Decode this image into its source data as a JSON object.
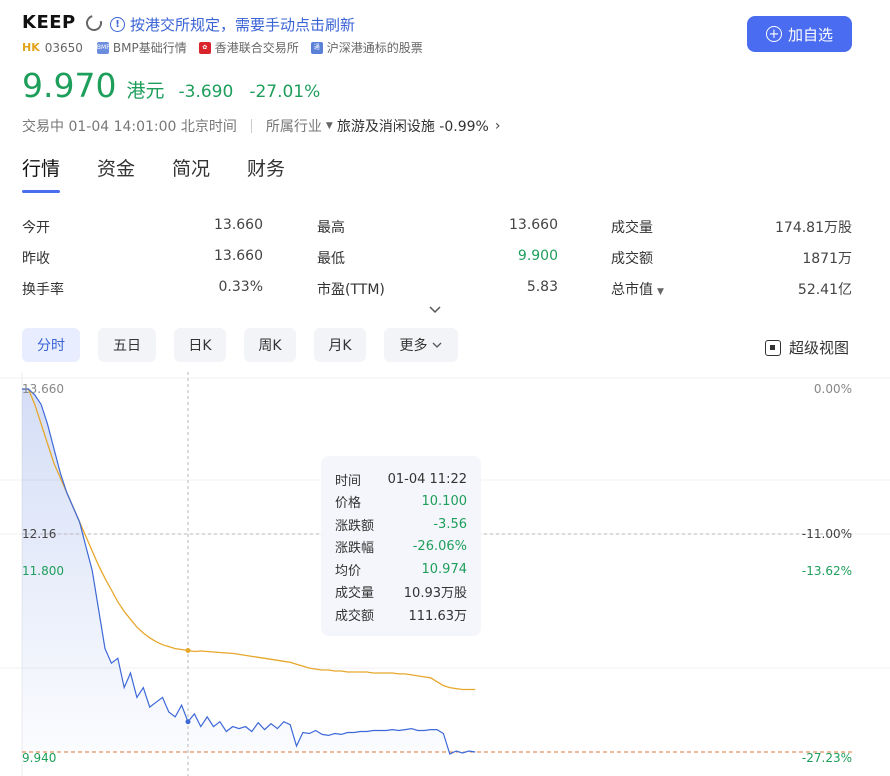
{
  "header": {
    "ticker": "KEEP",
    "notice": "按港交所规定，需要手动点击刷新",
    "market": "HK",
    "code": "03650",
    "badges": [
      "BMP基础行情",
      "香港联合交易所",
      "沪深港通标的股票"
    ],
    "add_button": "加自选"
  },
  "quote": {
    "price": "9.970",
    "currency": "港元",
    "change": "-3.690",
    "change_pct": "-27.01%",
    "status": "交易中 01-04 14:01:00 北京时间",
    "industry_label": "所属行业",
    "industry": "旅游及消闲设施",
    "industry_change": "-0.99%",
    "colors": {
      "down": "#1e9e5b",
      "accent": "#4a6cf0"
    }
  },
  "tabs": [
    "行情",
    "资金",
    "简况",
    "财务"
  ],
  "stats": [
    [
      {
        "label": "今开",
        "value": "13.660"
      },
      {
        "label": "最高",
        "value": "13.660"
      },
      {
        "label": "成交量",
        "value": "174.81万股"
      }
    ],
    [
      {
        "label": "昨收",
        "value": "13.660"
      },
      {
        "label": "最低",
        "value": "9.900"
      },
      {
        "label": "成交额",
        "value": "1871万"
      }
    ],
    [
      {
        "label": "换手率",
        "value": "0.33%"
      },
      {
        "label": "市盈(TTM)",
        "value": "5.83"
      },
      {
        "label": "总市值",
        "value": "52.41亿"
      }
    ]
  ],
  "periods": [
    "分时",
    "五日",
    "日K",
    "周K",
    "月K",
    "更多"
  ],
  "super_view": "超级视图",
  "chart_data": {
    "type": "line",
    "left_labels": [
      "13.660",
      "12.16",
      "11.800",
      "9.940"
    ],
    "right_labels": [
      "0.00%",
      "-11.00%",
      "-13.62%",
      "-27.23%"
    ],
    "series": [
      {
        "values": [
          13.66,
          13.66,
          13.6,
          13.5,
          13.3,
          13.05,
          12.8,
          12.6,
          12.45,
          12.3,
          12.05,
          11.8,
          11.4,
          11.0,
          10.85,
          10.9,
          10.6,
          10.75,
          10.5,
          10.6,
          10.4,
          10.45,
          10.5,
          10.35,
          10.3,
          10.42,
          10.25,
          10.33,
          10.2,
          10.3,
          10.2,
          10.25,
          10.15,
          10.2,
          10.18,
          10.2,
          10.15,
          10.24,
          10.17,
          10.23,
          10.18,
          10.25,
          10.22,
          10.0,
          10.14,
          10.13,
          10.16,
          10.12,
          10.11,
          10.13,
          10.12,
          10.14,
          10.14,
          10.15,
          10.15,
          10.16,
          10.16,
          10.16,
          10.17,
          10.16,
          10.17,
          10.18,
          10.16,
          10.16,
          10.17,
          10.17,
          10.13,
          9.92,
          9.95,
          9.93,
          9.95,
          9.94
        ]
      },
      {
        "values": [
          13.66,
          13.66,
          13.5,
          13.3,
          13.1,
          12.9,
          12.75,
          12.6,
          12.45,
          12.3,
          12.15,
          12.0,
          11.85,
          11.72,
          11.6,
          11.48,
          11.38,
          11.3,
          11.22,
          11.16,
          11.11,
          11.07,
          11.04,
          11.02,
          11.0,
          10.99,
          10.98,
          10.97,
          10.975,
          10.97,
          10.965,
          10.96,
          10.955,
          10.95,
          10.94,
          10.93,
          10.92,
          10.91,
          10.9,
          10.89,
          10.88,
          10.87,
          10.86,
          10.84,
          10.82,
          10.8,
          10.79,
          10.78,
          10.78,
          10.77,
          10.77,
          10.76,
          10.76,
          10.76,
          10.76,
          10.75,
          10.75,
          10.75,
          10.75,
          10.74,
          10.74,
          10.73,
          10.72,
          10.71,
          10.7,
          10.66,
          10.62,
          10.6,
          10.59,
          10.58,
          10.58,
          10.58
        ]
      }
    ],
    "cursor": {
      "time": "01-04 11:22",
      "price": "10.100",
      "change": "-3.56",
      "change_pct": "-26.06%",
      "avg_price": "10.974",
      "volume": "10.93万股",
      "amount": "111.63万"
    },
    "tooltip_labels": [
      "时间",
      "价格",
      "涨跌额",
      "涨跌幅",
      "均价",
      "成交量",
      "成交额"
    ],
    "colors": {
      "price": "#3d68d8",
      "avg": "#e6a72b",
      "prev_close": "#e0763a"
    }
  }
}
